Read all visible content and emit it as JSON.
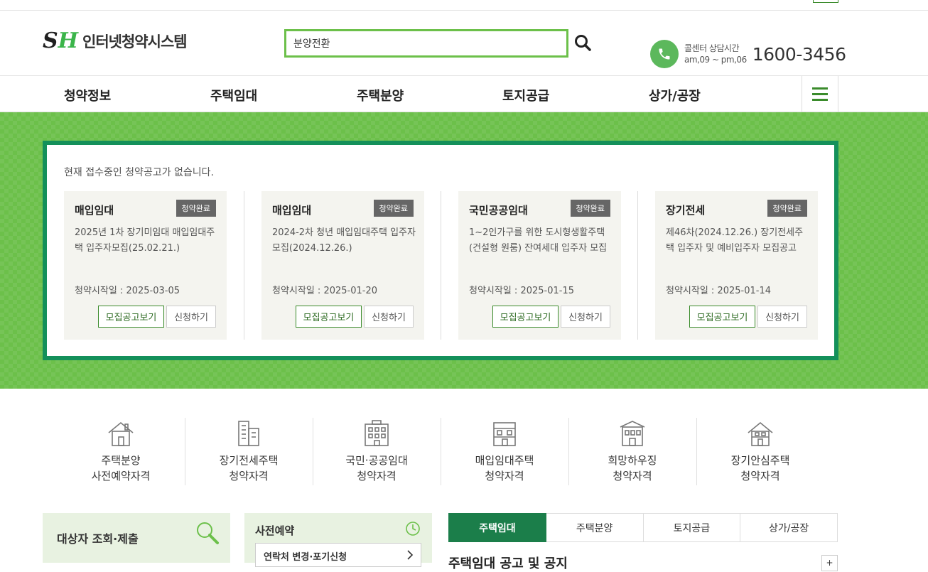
{
  "topbar": {
    "util_text": ""
  },
  "header": {
    "logo_mark_s": "S",
    "logo_mark_h": "H",
    "logo_text": "인터넷청약시스템",
    "search_value": "분양전환",
    "callcenter_label": "콜센터 상담시간",
    "callcenter_hours": "am,09 ~ pm,06",
    "callcenter_number": "1600-3456"
  },
  "gnb": {
    "items": [
      "청약정보",
      "주택임대",
      "주택분양",
      "토지공급",
      "상가/공장"
    ]
  },
  "banner": {
    "notice": "현재 접수중인 청약공고가 없습니다.",
    "cards": [
      {
        "title": "매입임대",
        "badge": "청약완료",
        "desc": "2025년 1차 장기미임대 매입임대주택 입주자모집(25.02.21.)",
        "date": "청약시작일 : 2025-03-05",
        "btn_notice": "모집공고보기",
        "btn_apply": "신청하기"
      },
      {
        "title": "매입임대",
        "badge": "청약완료",
        "desc": "2024-2차 청년 매입임대주택 입주자모집(2024.12.26.)",
        "date": "청약시작일 : 2025-01-20",
        "btn_notice": "모집공고보기",
        "btn_apply": "신청하기"
      },
      {
        "title": "국민공공임대",
        "badge": "청약완료",
        "desc": "1~2인가구를 위한 도시형생활주택(건설형 원룸) 잔여세대 입주자 모집",
        "date": "청약시작일 : 2025-01-15",
        "btn_notice": "모집공고보기",
        "btn_apply": "신청하기"
      },
      {
        "title": "장기전세",
        "badge": "청약완료",
        "desc": "제46차(2024.12.26.) 장기전세주택 입주자 및 예비입주자 모집공고",
        "date": "청약시작일 : 2025-01-14",
        "btn_notice": "모집공고보기",
        "btn_apply": "신청하기"
      }
    ]
  },
  "quick": {
    "items": [
      {
        "line1": "주택분양",
        "line2": "사전예약자격",
        "icon": "house-icon"
      },
      {
        "line1": "장기전세주택",
        "line2": "청약자격",
        "icon": "apartment-icon"
      },
      {
        "line1": "국민·공공임대",
        "line2": "청약자격",
        "icon": "building-icon"
      },
      {
        "line1": "매입임대주택",
        "line2": "청약자격",
        "icon": "row-house-icon"
      },
      {
        "line1": "희망하우징",
        "line2": "청약자격",
        "icon": "dormitory-icon"
      },
      {
        "line1": "장기안심주택",
        "line2": "청약자격",
        "icon": "home-icon"
      }
    ]
  },
  "bottom": {
    "box1_title": "대상자 조회·제출",
    "box2_title": "사전예약",
    "box2_sub": "연락처 변경·포기신청",
    "tabs": [
      "주택임대",
      "주택분양",
      "토지공급",
      "상가/공장"
    ],
    "section_title": "주택임대 공고 및 공지",
    "more": "+"
  },
  "colors": {
    "brand_green": "#6cc04a",
    "panel_border": "#14905a",
    "tab_active": "#1b7e4a",
    "badge_gray": "#666666"
  }
}
